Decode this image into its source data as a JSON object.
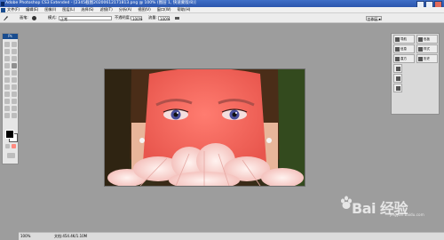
{
  "window": {
    "title": "Adobe Photoshop CS3 Extended - [2345截图20200612171813.png @ 100% (图层 1, 快速蒙版/8)]"
  },
  "menu": {
    "items": [
      "文件(F)",
      "编辑(E)",
      "图像(I)",
      "图层(L)",
      "选择(S)",
      "滤镜(T)",
      "分析(A)",
      "视图(V)",
      "窗口(W)",
      "帮助(H)"
    ]
  },
  "options": {
    "brush_label": "画笔:",
    "mode_label": "模式:",
    "mode_value": "正常",
    "opacity_label": "不透明度:",
    "opacity_value": "100%",
    "flow_label": "流量:",
    "flow_value": "100%",
    "workspace_label": "工作区 ▾"
  },
  "toolbox": {
    "title": "Ps"
  },
  "panels": {
    "left_column": [
      "导航",
      "信息",
      "直方"
    ],
    "right_column": [
      "色板",
      "样式",
      "历史"
    ]
  },
  "status": {
    "zoom": "100%",
    "doc_info": "文档:454.4K/1.10M"
  },
  "watermark": {
    "text": "Bai 经验",
    "url": "jingyan.baidu.com"
  },
  "colors": {
    "quick_mask_overlay": "#ff6e62",
    "workspace_bg": "#9d9d9d",
    "title_bar": "#2b55ad"
  }
}
